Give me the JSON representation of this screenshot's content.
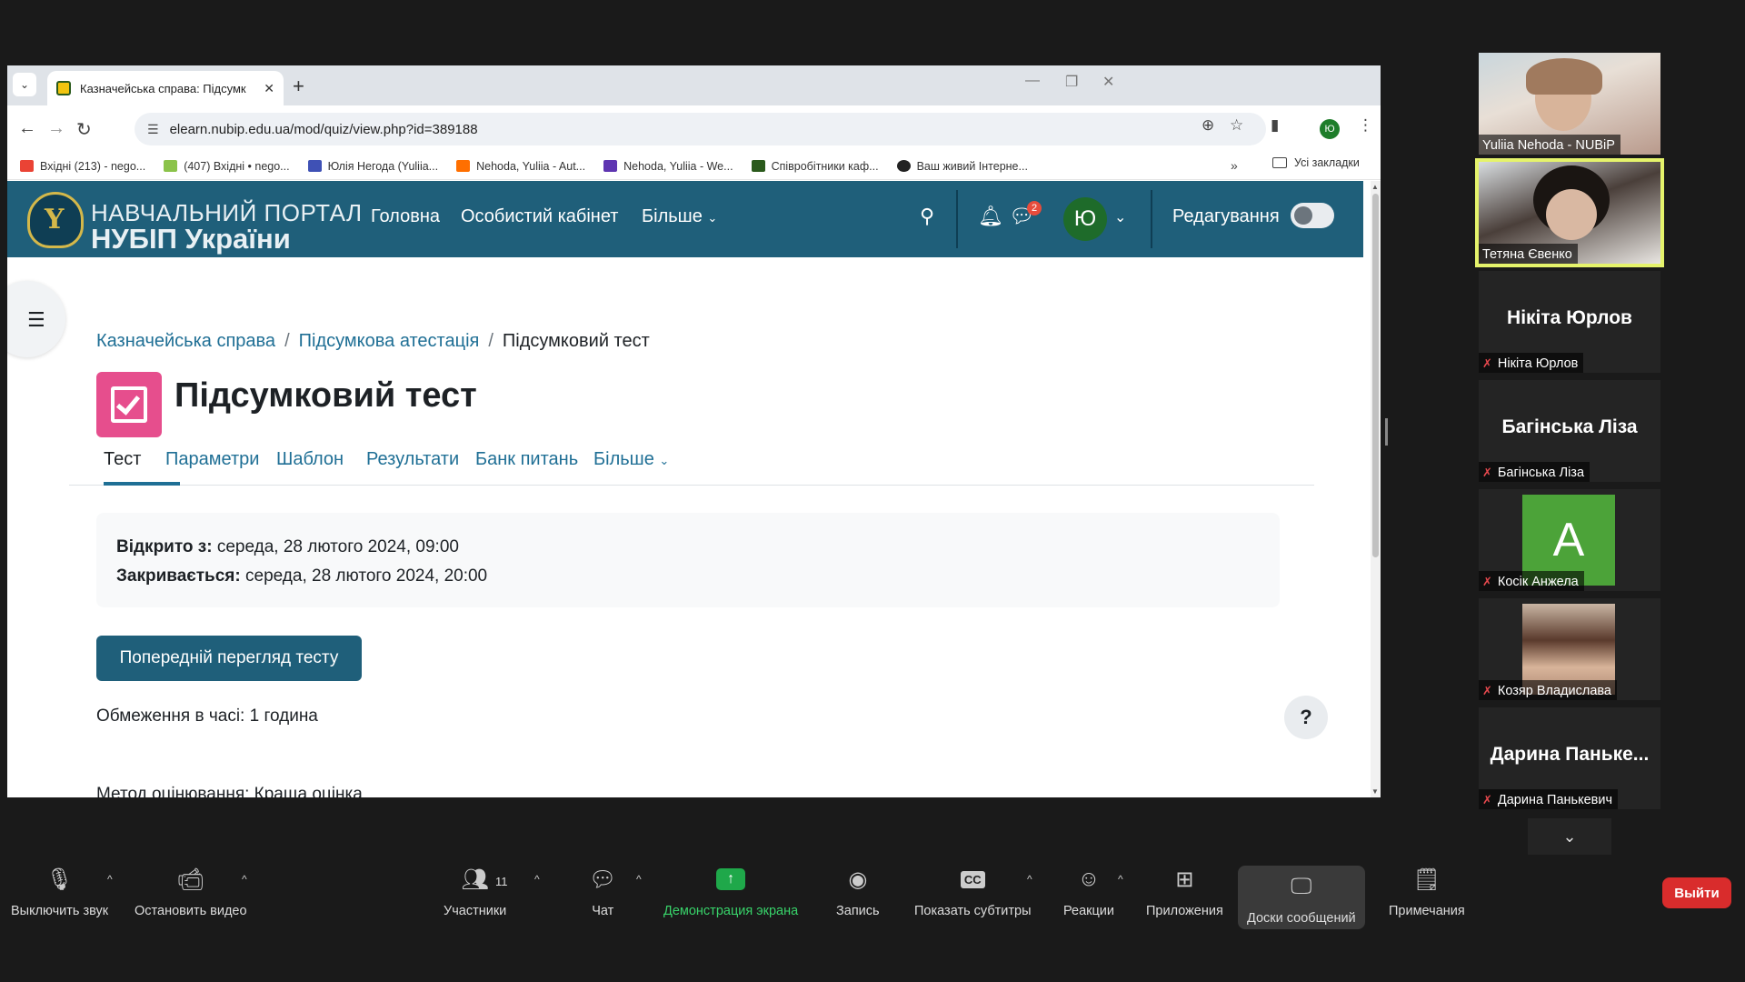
{
  "browser": {
    "tab_title": "Казначейська справа: Підсумк",
    "url": "elearn.nubip.edu.ua/mod/quiz/view.php?id=389188",
    "profile_initial": "Ю",
    "bookmarks": [
      "Вхідні (213) - nego...",
      "(407) Вхідні • nego...",
      "Юлія Негода (Yuliia...",
      "Nehoda, Yuliia - Aut...",
      "Nehoda, Yuliia - We...",
      "Співробітники каф...",
      "Ваш живий Інтерне..."
    ],
    "all_bookmarks": "Усі закладки"
  },
  "site": {
    "logo_line1": "НАВЧАЛЬНИЙ ПОРТАЛ",
    "logo_line2": "НУБІП України",
    "nav_home": "Головна",
    "nav_cabinet": "Особистий кабінет",
    "nav_more": "Більше",
    "messages_badge": "2",
    "user_initial": "Ю",
    "edit_mode": "Редагування"
  },
  "page": {
    "breadcrumb": [
      "Казначейська справа",
      "Підсумкова атестація",
      "Підсумковий тест"
    ],
    "title": "Підсумковий тест",
    "tabs": [
      "Тест",
      "Параметри",
      "Шаблон",
      "Результати",
      "Банк питань",
      "Більше"
    ],
    "opened_label": "Відкрито з:",
    "opened_value": "середа, 28 лютого 2024, 09:00",
    "closes_label": "Закривається:",
    "closes_value": "середа, 28 лютого 2024, 20:00",
    "preview_button": "Попередній перегляд тесту",
    "time_limit": "Обмеження в часі: 1 година",
    "grading_cut": "Метод оцінювання: Краща оцінка",
    "help": "?"
  },
  "participants": [
    {
      "name": "Yuliia Nehoda - NUBiP",
      "video": true
    },
    {
      "name": "Тетяна Євенко",
      "video": true
    },
    {
      "display": "Нікіта Юрлов",
      "name": "Нікіта Юрлов"
    },
    {
      "display": "Багінська Ліза",
      "name": "Багінська Ліза"
    },
    {
      "avatar": "A",
      "name": "Косік Анжела"
    },
    {
      "name": "Козяр Владислава"
    },
    {
      "display": "Дарина Паньке...",
      "name": "Дарина Панькевич"
    }
  ],
  "zoom_toolbar": {
    "mute": "Выключить звук",
    "video": "Остановить видео",
    "participants": "Участники",
    "participants_count": "11",
    "chat": "Чат",
    "share": "Демонстрация экрана",
    "record": "Запись",
    "captions": "Показать субтитры",
    "reactions": "Реакции",
    "apps": "Приложения",
    "whiteboards": "Доски сообщений",
    "notes": "Примечания",
    "leave": "Выйти"
  }
}
